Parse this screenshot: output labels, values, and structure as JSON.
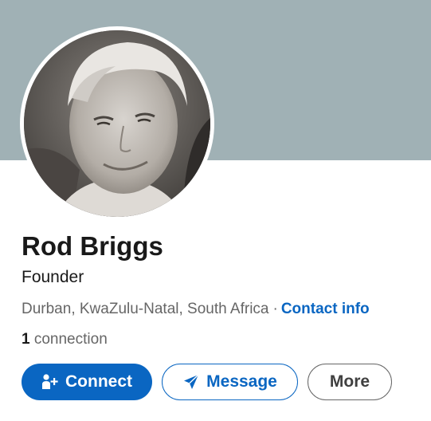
{
  "profile": {
    "name": "Rod Briggs",
    "headline": "Founder",
    "location": "Durban, KwaZulu-Natal, South Africa",
    "separator": "·",
    "contact_info_label": "Contact info",
    "connections_count": "1",
    "connections_label": " connection"
  },
  "actions": {
    "connect_label": "Connect",
    "message_label": "Message",
    "more_label": "More"
  },
  "icons": {
    "connect": "add-person-icon",
    "message": "send-arrow-icon"
  },
  "colors": {
    "banner": "#a0b1b5",
    "accent": "#0a66c2",
    "text_primary": "#191919",
    "text_secondary": "#666666"
  }
}
